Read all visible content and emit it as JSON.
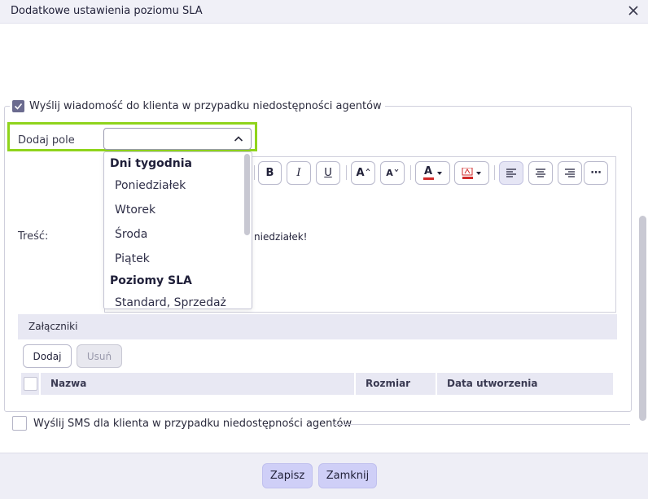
{
  "dialog": {
    "title": "Dodatkowe ustawienia poziomu SLA"
  },
  "email_section": {
    "checkbox_label": "Wyślij wiadomość do klienta w przypadku niedostępności agentów",
    "checked": true,
    "add_field_label": "Dodaj pole",
    "add_field_value": "",
    "content_label": "Treść:",
    "editor_text": "niedziałek!"
  },
  "toolbar": {
    "bold": "B",
    "italic": "I",
    "underline": "U",
    "font_increase": "A",
    "font_decrease": "A",
    "font_color": "A",
    "more": "⋯"
  },
  "dropdown": {
    "groups": [
      {
        "label": "Dni tygodnia",
        "items": [
          "Poniedziałek",
          "Wtorek",
          "Środa",
          "Piątek"
        ]
      },
      {
        "label": "Poziomy SLA",
        "items": [
          "Standard, Sprzedaż"
        ]
      }
    ]
  },
  "attachments": {
    "header": "Załączniki",
    "add_button": "Dodaj",
    "remove_button": "Usuń",
    "columns": [
      "Nazwa",
      "Rozmiar",
      "Data utworzenia"
    ]
  },
  "sms_section": {
    "checkbox_label": "Wyślij SMS dla klienta w przypadku niedostępności agentów",
    "checked": false
  },
  "footer": {
    "save_button": "Zapisz",
    "close_button": "Zamknij"
  },
  "colors": {
    "highlight": "#8fd41c",
    "primary_button": "#cfcff7",
    "checkbox_checked": "#6b6b8f"
  }
}
